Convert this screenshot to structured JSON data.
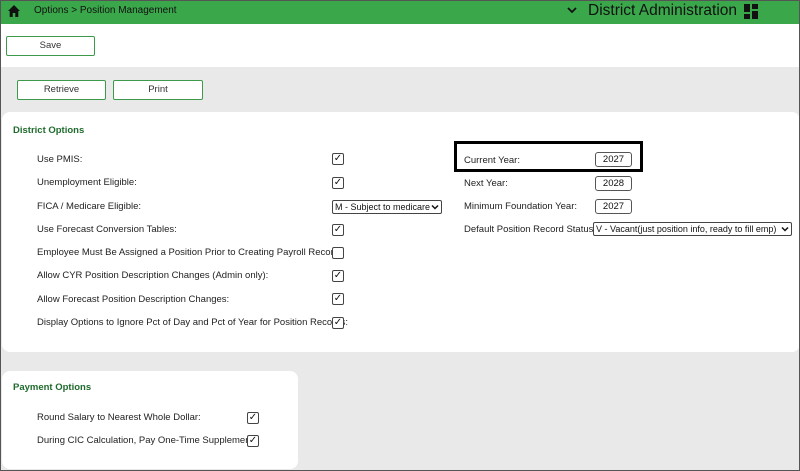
{
  "header": {
    "breadcrumb": "Options > Position Management",
    "title": "District Administration",
    "icons": {
      "home": "home-icon",
      "dropdown": "chevron-down-icon",
      "apps": "apps-grid-icon"
    }
  },
  "toolbar": {
    "save_label": "Save"
  },
  "actions": {
    "retrieve_label": "Retrieve",
    "print_label": "Print"
  },
  "district_options": {
    "title": "District Options",
    "use_pmis": {
      "label": "Use PMIS:",
      "checked": true
    },
    "unemployment_eligible": {
      "label": "Unemployment Eligible:",
      "checked": true
    },
    "fica": {
      "label": "FICA / Medicare Eligible:",
      "value": "M - Subject to medicare"
    },
    "forecast_tables": {
      "label": "Use Forecast Conversion Tables:",
      "checked": true
    },
    "position_required": {
      "label": "Employee Must Be Assigned a Position Prior to Creating Payroll Record:",
      "checked": false
    },
    "cyr_changes": {
      "label": "Allow CYR Position Description Changes (Admin only):",
      "checked": true
    },
    "forecast_changes": {
      "label": "Allow Forecast Position Description Changes:",
      "checked": true
    },
    "ignore_pct": {
      "label": "Display Options to Ignore Pct of Day and Pct of Year for Position Records:",
      "checked": true
    },
    "current_year": {
      "label": "Current Year:",
      "value": "2027"
    },
    "next_year": {
      "label": "Next Year:",
      "value": "2028"
    },
    "min_foundation_year": {
      "label": "Minimum Foundation Year:",
      "value": "2027"
    },
    "default_status": {
      "label": "Default Position Record Status:",
      "value": "V - Vacant(just position info, ready to fill emp)"
    }
  },
  "payment_options": {
    "title": "Payment Options",
    "round_salary": {
      "label": "Round Salary to Nearest Whole Dollar:",
      "checked": true
    },
    "cic_supplement": {
      "label": "During CIC Calculation, Pay One-Time Supplement:",
      "checked": true
    }
  },
  "check_glyph": "✓",
  "colors": {
    "header_green": "#3aa84a",
    "section_title": "#1f6b2d",
    "button_border": "#3d9a4b"
  }
}
